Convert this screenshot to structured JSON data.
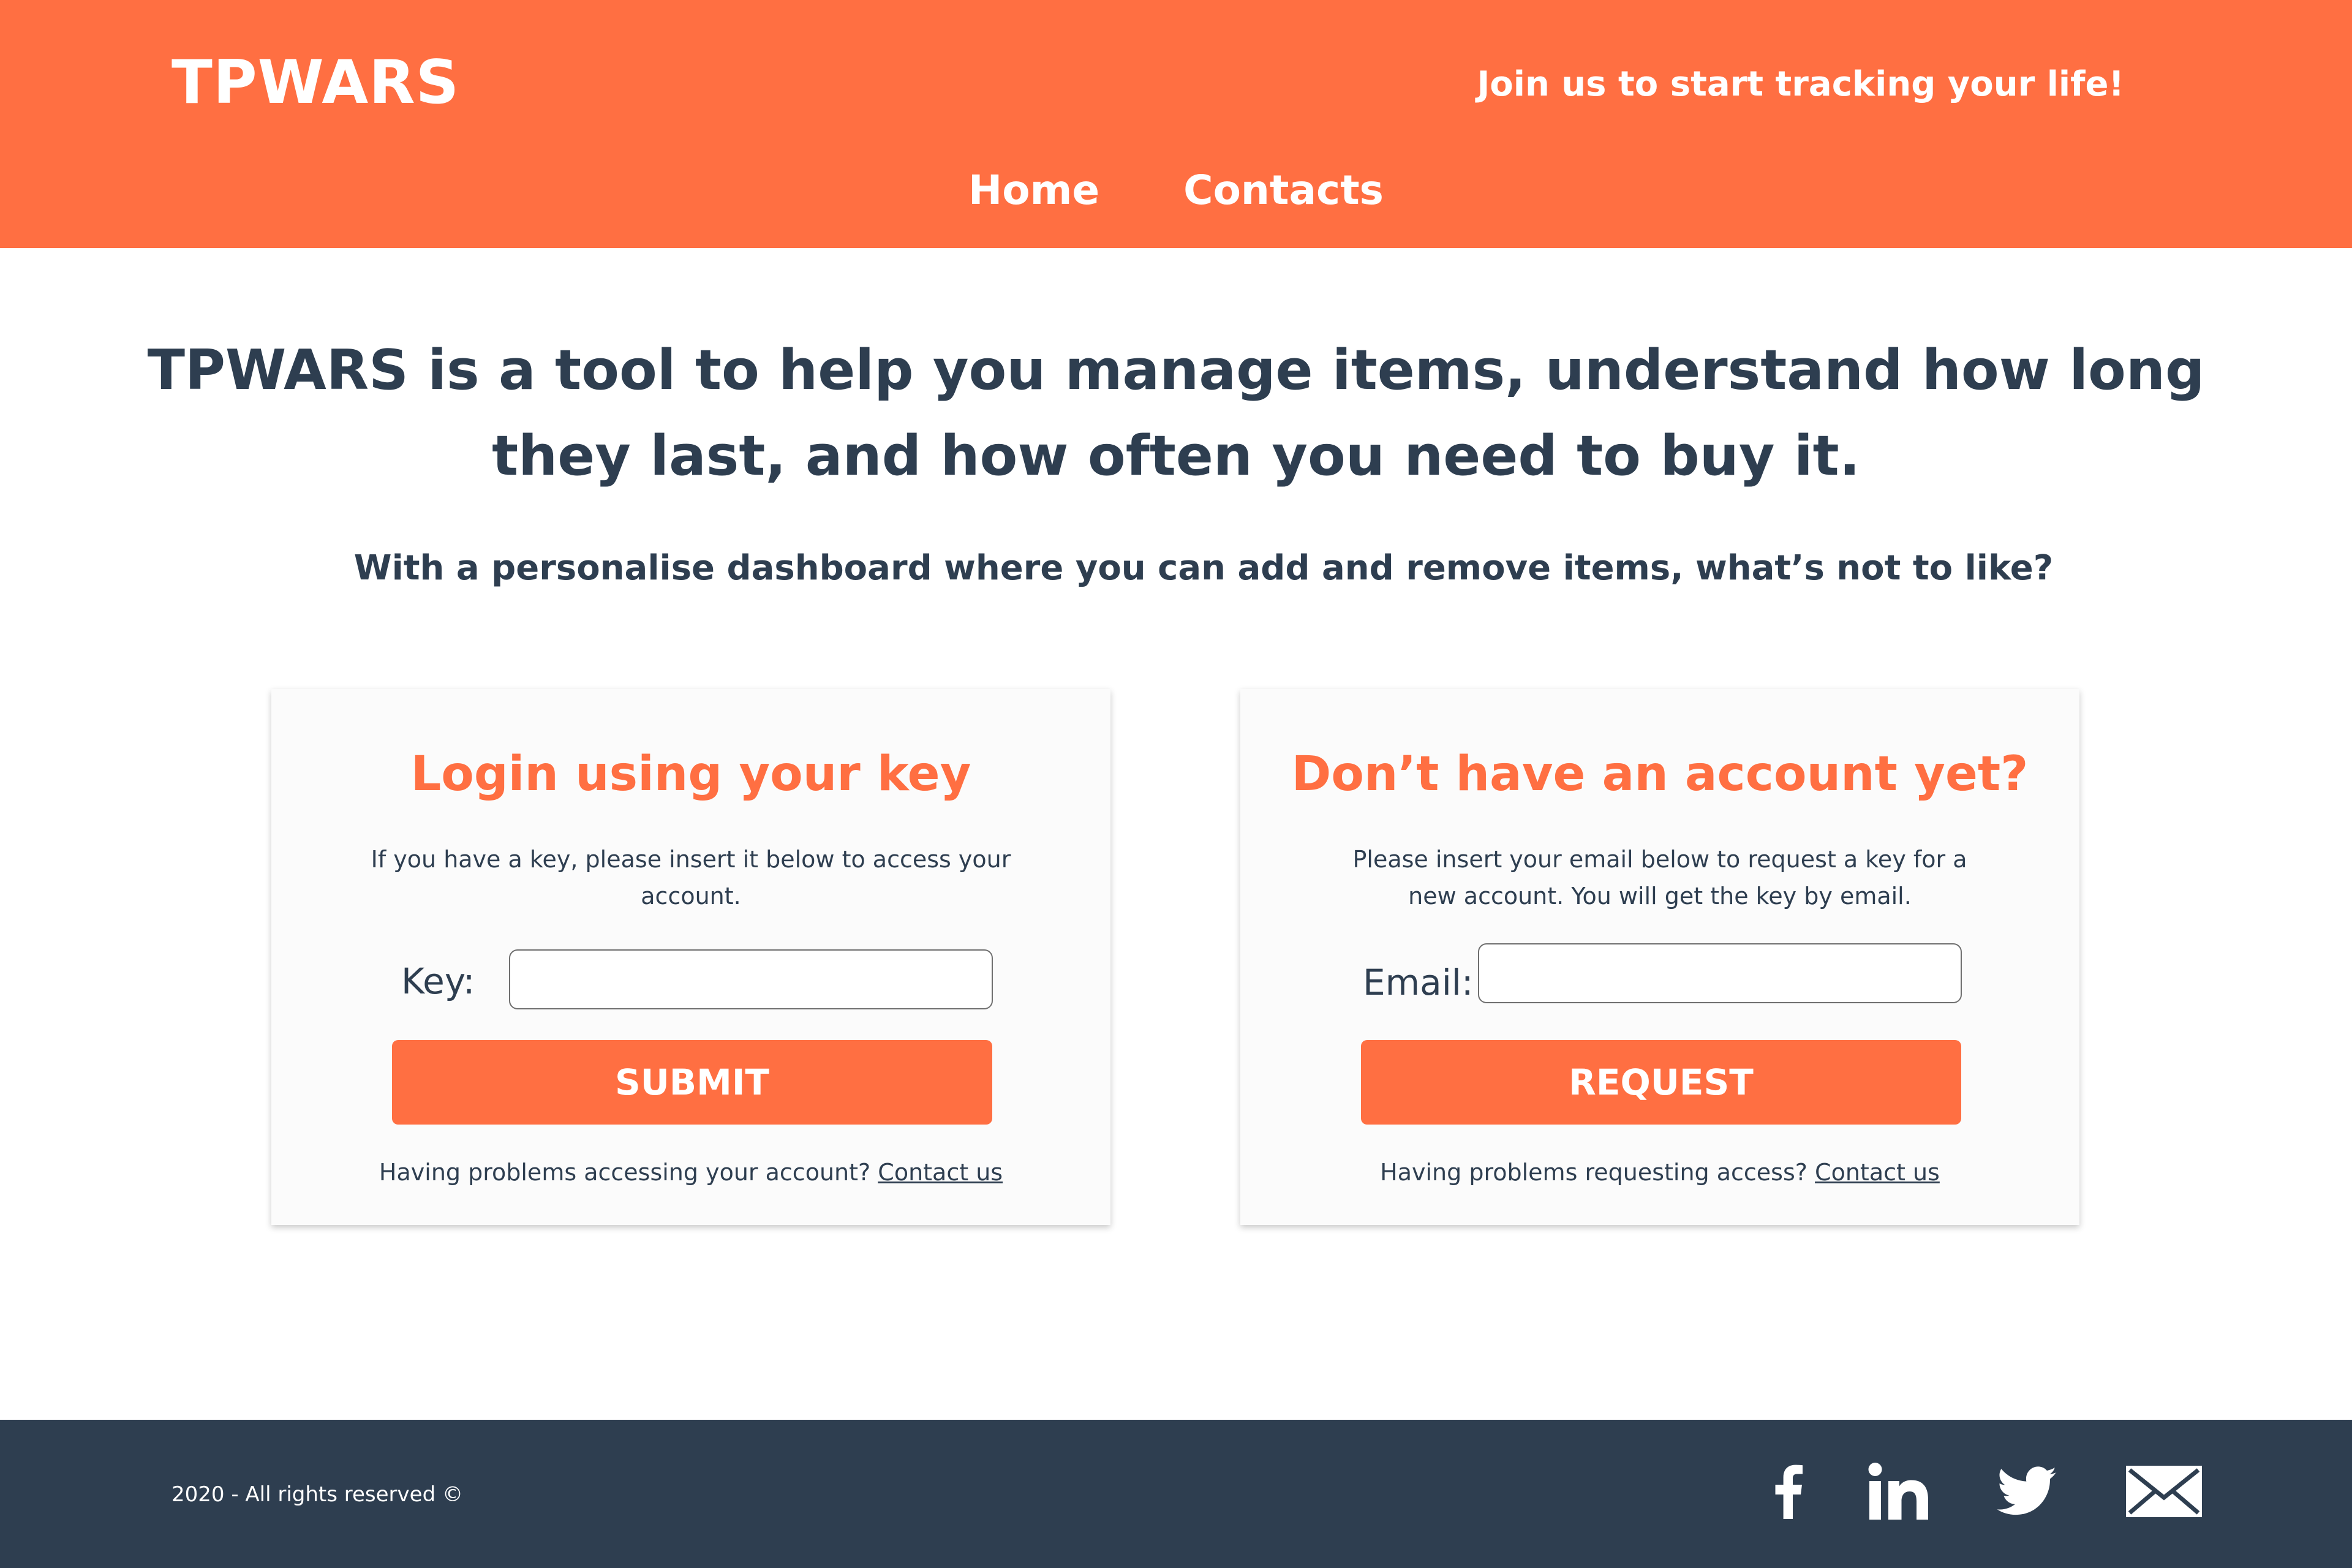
{
  "header": {
    "logo": "TPWARS",
    "tagline": "Join us to start tracking your life!",
    "nav": [
      {
        "label": "Home"
      },
      {
        "label": "Contacts"
      }
    ]
  },
  "hero": {
    "title_line1": "TPWARS is a tool to help you manage items, understand how long",
    "title_line2": "they last, and how often you need to buy it.",
    "subtitle": "With a personalise dashboard where you can add and remove items, what’s not to like?"
  },
  "login_card": {
    "title": "Login using your key",
    "description": "If you have a key, please insert it below to access your account.",
    "field_label": "Key:",
    "field_value": "",
    "button_label": "SUBMIT",
    "help_text": "Having problems accessing your account?",
    "help_link": "Contact us"
  },
  "request_card": {
    "title": "Don’t have an account yet?",
    "description": "Please insert your email below to request a key for a new account. You will get the key by email.",
    "field_label": "Email:",
    "field_value": "",
    "button_label": "REQUEST",
    "help_text": "Having problems requesting access?",
    "help_link": "Contact us"
  },
  "footer": {
    "copyright": "2020 - All rights reserved ©",
    "social_icons": [
      "facebook-icon",
      "linkedin-icon",
      "twitter-icon",
      "mail-icon"
    ]
  },
  "colors": {
    "accent": "#ff6f42",
    "dark": "#2e3e50",
    "card_bg": "#fbfbfb"
  }
}
